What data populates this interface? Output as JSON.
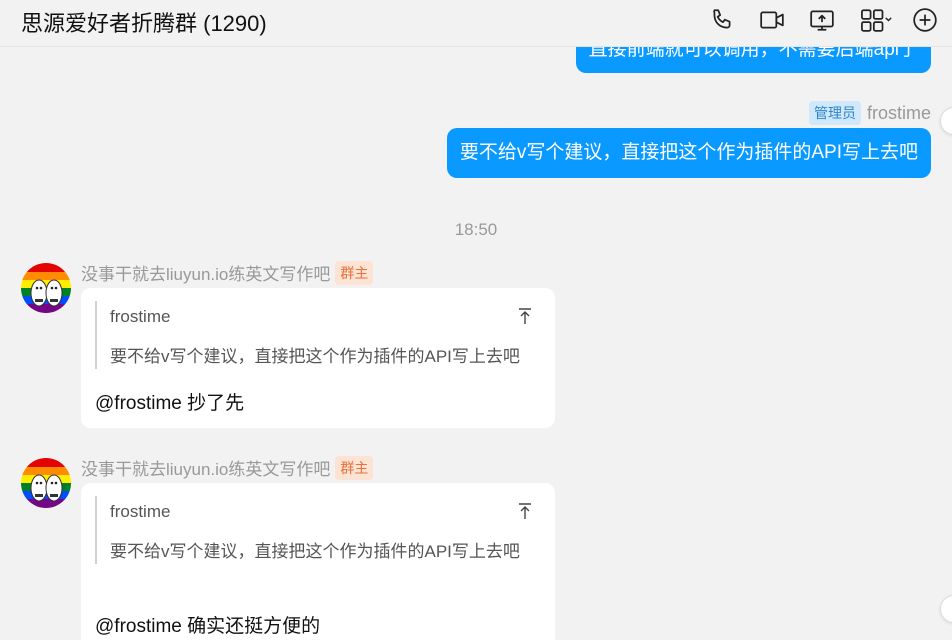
{
  "header": {
    "title": "思源爱好者折腾群 (1290)",
    "icons": [
      "phone-icon",
      "video-icon",
      "screen-share-icon",
      "apps-icon",
      "add-icon"
    ]
  },
  "messages": {
    "top_partial": "直接前端就可以调用，不需要后端api了",
    "sent_badge": "管理员",
    "sent_name": "frostime",
    "sent_text": "要不给v写个建议，直接把这个作为插件的API写上去吧",
    "time": "18:50",
    "replies": [
      {
        "name": "没事干就去liuyun.io练英文写作吧",
        "badge": "群主",
        "quote_author": "frostime",
        "quote_text": "要不给v写个建议，直接把这个作为插件的API写上去吧",
        "text": "@frostime 抄了先"
      },
      {
        "name": "没事干就去liuyun.io练英文写作吧",
        "badge": "群主",
        "quote_author": "frostime",
        "quote_text": "要不给v写个建议，直接把这个作为插件的API写上去吧",
        "text": "@frostime 确实还挺方便的"
      }
    ]
  },
  "colors": {
    "accent": "#0a99ff",
    "admin_badge": "#cfe8fb",
    "owner_badge": "#fde3d3",
    "background": "#f2f2f2"
  }
}
